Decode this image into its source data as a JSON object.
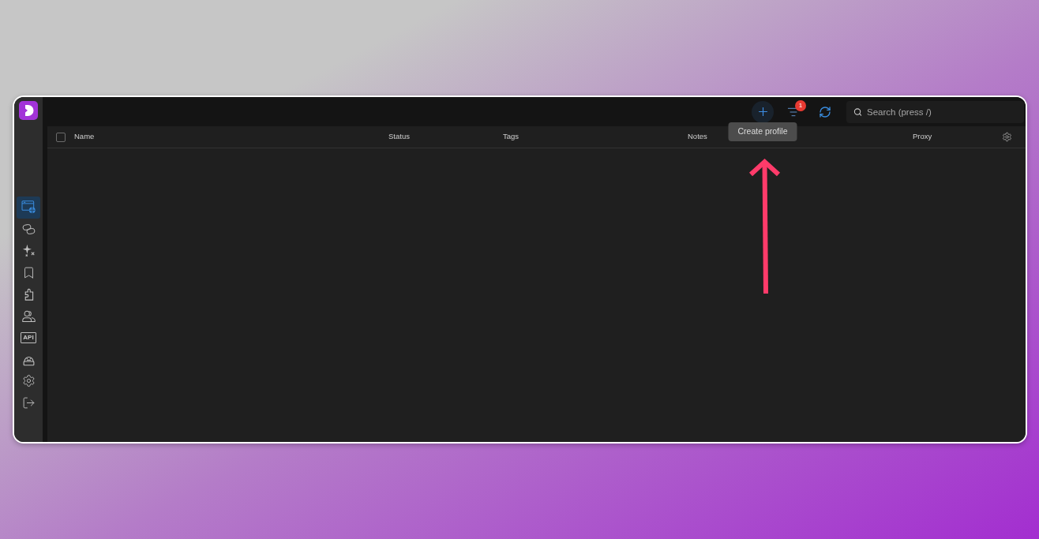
{
  "sidebar": {
    "items": [
      {
        "selected": true
      },
      {
        "selected": false
      },
      {
        "selected": false
      },
      {
        "selected": false
      },
      {
        "selected": false
      },
      {
        "selected": false
      },
      {
        "label": "API",
        "selected": false
      },
      {
        "selected": false
      },
      {
        "selected": false
      },
      {
        "selected": false
      }
    ]
  },
  "toolbar": {
    "create_profile": {
      "tooltip": "Create profile"
    },
    "filters": {
      "badge": "1"
    },
    "search": {
      "placeholder": "Search (press /)"
    }
  },
  "table": {
    "select_all": {
      "checked": false
    },
    "columns": [
      "Name",
      "Status",
      "Tags",
      "Notes",
      "Proxy"
    ]
  }
}
